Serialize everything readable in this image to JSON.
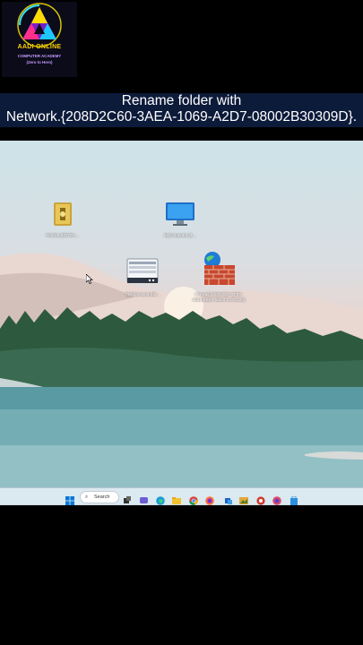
{
  "logo": {
    "brand": "AADI ONLINE",
    "subtitle": "COMPUTER ACADEMY",
    "tagline": "(Zero to Hero)"
  },
  "caption": {
    "line1": "Rename folder with",
    "line2": "Network.{208D2C60-3AEA-1069-A2D7-08002B30309D}."
  },
  "desktop": {
    "icons": [
      {
        "name": "winrar-icon",
        "label": "WinRar.{ED7BA…"
      },
      {
        "name": "my-computer-icon",
        "label": "MyComputer.{2…"
      },
      {
        "name": "taskbar-settings-icon",
        "label": "TaskbarIcons.{05…"
      },
      {
        "name": "firewall-icon",
        "label": "Firewall.{4026492F-2F69-46B8-B9BF-5654FC07E423}"
      }
    ]
  },
  "taskbar": {
    "search_label": "Search",
    "apps": [
      "start",
      "search",
      "task-view",
      "chat",
      "edge",
      "file-explorer",
      "chrome",
      "firefox",
      "mail",
      "photos",
      "word",
      "terminal",
      "opera",
      "store"
    ]
  }
}
